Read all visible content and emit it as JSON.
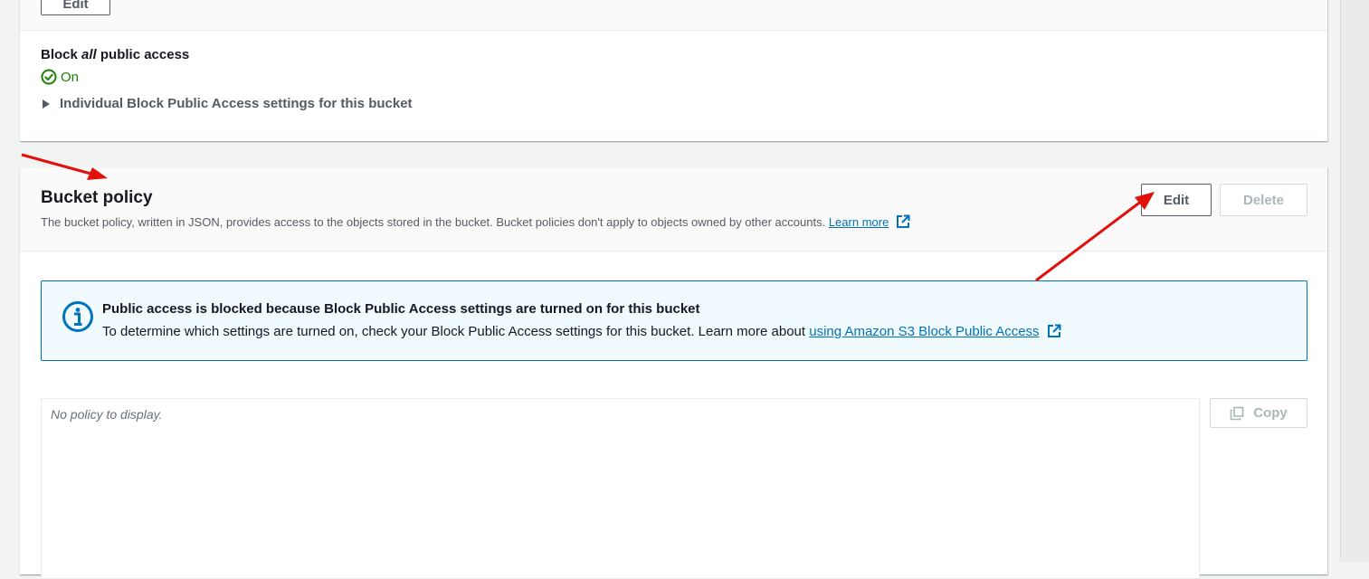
{
  "top_panel": {
    "edit_label": "Edit",
    "block_all_prefix": "Block ",
    "block_all_em": "all",
    "block_all_suffix": " public access",
    "status_text": "On",
    "individual_settings_label": "Individual Block Public Access settings for this bucket"
  },
  "bucket_policy": {
    "title": "Bucket policy",
    "description": "The bucket policy, written in JSON, provides access to the objects stored in the bucket. Bucket policies don't apply to objects owned by other accounts.",
    "learn_more_label": "Learn more",
    "edit_label": "Edit",
    "delete_label": "Delete",
    "alert": {
      "title": "Public access is blocked because Block Public Access settings are turned on for this bucket",
      "body": "To determine which settings are turned on, check your Block Public Access settings for this bucket. Learn more about",
      "link_label": "using Amazon S3 Block Public Access"
    },
    "policy_placeholder": "No policy to display.",
    "copy_label": "Copy"
  },
  "colors": {
    "accent_link": "#0073bb",
    "success_green": "#1d8102",
    "info_blue": "#0073bb",
    "annotation_red": "#e0110b"
  },
  "icons": [
    "check-circle-icon",
    "caret-right-icon",
    "external-link-icon",
    "info-icon",
    "copy-icon"
  ]
}
